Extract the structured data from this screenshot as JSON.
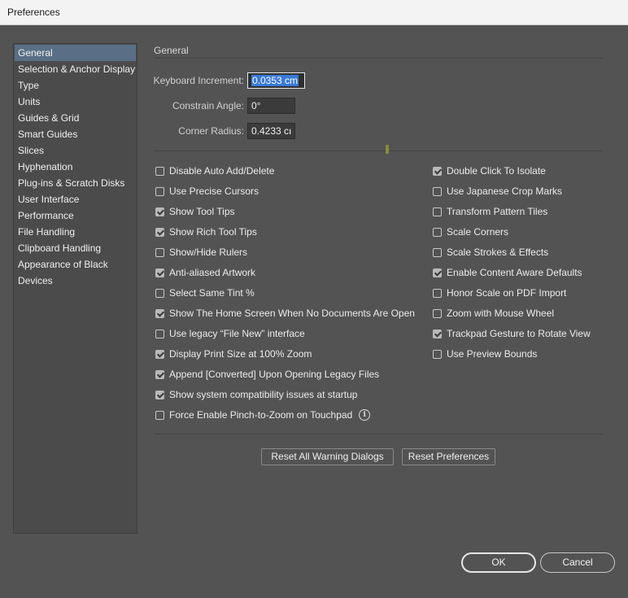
{
  "window": {
    "title": "Preferences"
  },
  "sidebar": {
    "items": [
      "General",
      "Selection & Anchor Display",
      "Type",
      "Units",
      "Guides & Grid",
      "Smart Guides",
      "Slices",
      "Hyphenation",
      "Plug-ins & Scratch Disks",
      "User Interface",
      "Performance",
      "File Handling",
      "Clipboard Handling",
      "Appearance of Black",
      "Devices"
    ],
    "selected": "General"
  },
  "general": {
    "section_title": "General",
    "keyboard_increment": {
      "label": "Keyboard Increment:",
      "value": "0.0353 cm"
    },
    "constrain_angle": {
      "label": "Constrain Angle:",
      "value": "0°"
    },
    "corner_radius": {
      "label": "Corner Radius:",
      "value": "0.4233 cı"
    },
    "left_options": [
      {
        "label": "Disable Auto Add/Delete",
        "checked": false
      },
      {
        "label": "Use Precise Cursors",
        "checked": false
      },
      {
        "label": "Show Tool Tips",
        "checked": true
      },
      {
        "label": "Show Rich Tool Tips",
        "checked": true
      },
      {
        "label": "Show/Hide Rulers",
        "checked": false
      },
      {
        "label": "Anti-aliased Artwork",
        "checked": true
      },
      {
        "label": "Select Same Tint %",
        "checked": false
      },
      {
        "label": "Show The Home Screen When No Documents Are Open",
        "checked": true
      },
      {
        "label": "Use legacy “File New” interface",
        "checked": false
      },
      {
        "label": "Display Print Size at 100% Zoom",
        "checked": true
      },
      {
        "label": "Append [Converted] Upon Opening Legacy Files",
        "checked": true
      },
      {
        "label": "Show system compatibility issues at startup",
        "checked": true
      },
      {
        "label": "Force Enable Pinch-to-Zoom on Touchpad",
        "checked": false,
        "info_icon": "info-icon"
      }
    ],
    "right_options": [
      {
        "label": "Double Click To Isolate",
        "checked": true
      },
      {
        "label": "Use Japanese Crop Marks",
        "checked": false
      },
      {
        "label": "Transform Pattern Tiles",
        "checked": false
      },
      {
        "label": "Scale Corners",
        "checked": false
      },
      {
        "label": "Scale Strokes & Effects",
        "checked": false
      },
      {
        "label": "Enable Content Aware Defaults",
        "checked": true
      },
      {
        "label": "Honor Scale on PDF Import",
        "checked": false
      },
      {
        "label": "Zoom with Mouse Wheel",
        "checked": false
      },
      {
        "label": "Trackpad Gesture to Rotate View",
        "checked": true
      },
      {
        "label": "Use Preview Bounds",
        "checked": false
      }
    ],
    "reset_warnings_label": "Reset All Warning Dialogs",
    "reset_prefs_label": "Reset Preferences",
    "info_glyph": "i"
  },
  "footer": {
    "ok_label": "OK",
    "cancel_label": "Cancel"
  },
  "colors": {
    "background": "#535353",
    "selection": "#5a6f86",
    "focus": "#3a79d8"
  }
}
